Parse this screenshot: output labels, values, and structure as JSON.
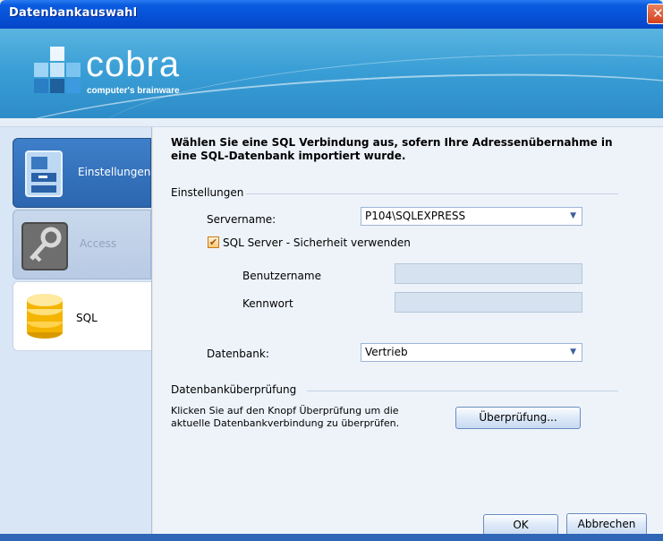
{
  "window": {
    "title": "Datenbankauswahl"
  },
  "banner": {
    "brand": "cobra",
    "tagline": "computer's brainware"
  },
  "sidebar": {
    "items": [
      {
        "label": "Einstellungen",
        "icon": "settings-cabinet-icon",
        "state": "active"
      },
      {
        "label": "Access",
        "icon": "key-icon",
        "state": "disabled"
      },
      {
        "label": "SQL",
        "icon": "database-icon",
        "state": "selected"
      }
    ]
  },
  "main": {
    "intro": "Wählen Sie eine SQL Verbindung aus, sofern Ihre Adressenübernahme in eine SQL-Datenbank importiert wurde.",
    "settings_group": "Einstellungen",
    "servername_label": "Servername:",
    "servername_value": "P104\\SQLEXPRESS",
    "sql_security_label": "SQL Server - Sicherheit verwenden",
    "sql_security_checked": true,
    "username_label": "Benutzername",
    "username_value": "",
    "password_label": "Kennwort",
    "password_value": "",
    "database_label": "Datenbank:",
    "database_value": "Vertrieb",
    "check_group": "Datenbanküberprüfung",
    "check_text_1": "Klicken Sie auf den Knopf Überprüfung um die",
    "check_text_2": "aktuelle Datenbankverbindung zu überprüfen.",
    "check_button": "Überprüfung..."
  },
  "footer": {
    "ok_label": "OK",
    "cancel_label": "Abbrechen"
  },
  "colors": {
    "title_bar": "#0650d6",
    "banner": "#3a9fd6",
    "sidebar_active": "#2c66b0",
    "close_button": "#d4401c"
  }
}
